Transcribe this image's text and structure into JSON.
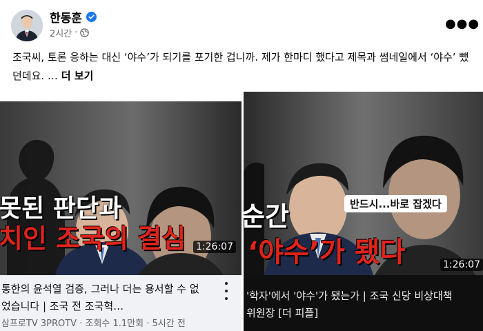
{
  "post": {
    "author": "한동훈",
    "time": "2시간",
    "dot": "·",
    "text": "조국씨, 토론 응하는 대신 ‘야수’가 되기를 포기한 겁니까. 제가 한마디 했다고 제목과 썸네일에서 ‘야수’ 뺐던데요. …",
    "see_more": "더 보기",
    "icons": {
      "verified": "verified-badge-icon",
      "audience": "globe-icon",
      "menu": "more-horizontal-icon"
    },
    "colors": {
      "verified": "#1877f2",
      "meta": "#65676b"
    }
  },
  "left_card": {
    "caption_line1": "못된 판단과",
    "caption_line2": "치인 조국의 결심",
    "duration": "1:26:07",
    "title": "통한의 윤석열 검증, 그러나 더는 용서할 수 없었습니다 | 조국 전 조국혁…",
    "channel": "삼프로TV 3PROTV",
    "views": "조회수 1.1만회",
    "uploaded": "5시간 전",
    "sep": "·"
  },
  "right_card": {
    "caption_line1": "순간",
    "caption_bubble": "반드시...바로 잡겠다",
    "caption_line2": "‘야수’가 됐다",
    "duration": "1:26:07",
    "title": "'학자'에서 '야수'가 됐는가 | 조국 신당 비상대책위원장 [더 피플]"
  },
  "colors": {
    "caption_red": "#e0241c",
    "accent": "#1877f2"
  }
}
